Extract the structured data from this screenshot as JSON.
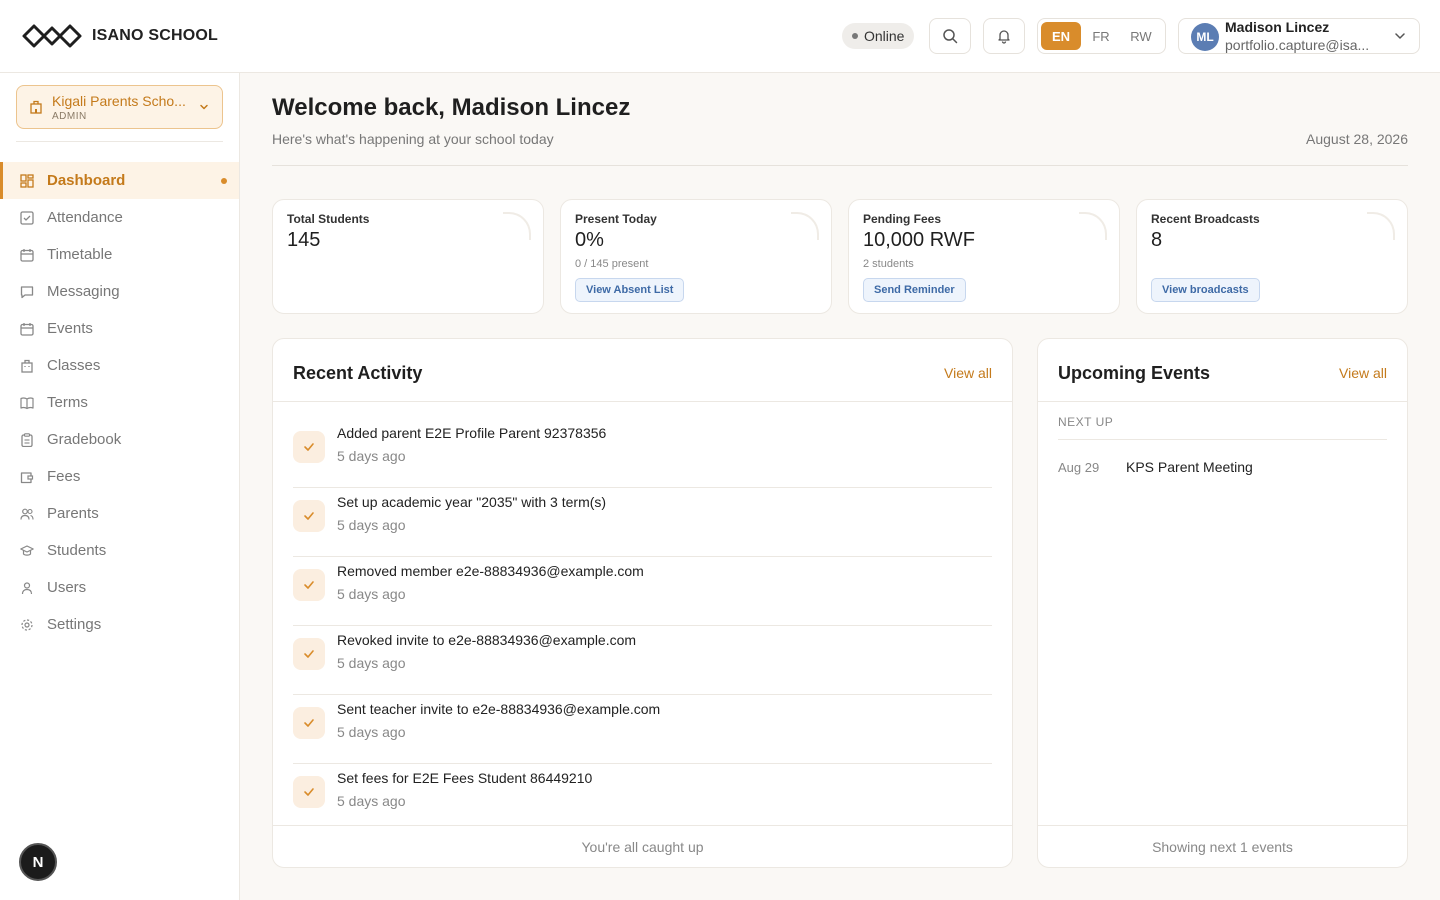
{
  "app": {
    "brand": "ISANO SCHOOL",
    "status": "Online",
    "languages": [
      "EN",
      "FR",
      "RW"
    ],
    "active_language": "EN"
  },
  "user": {
    "initials": "ML",
    "name": "Madison Lincez",
    "email": "portfolio.capture@isa..."
  },
  "school": {
    "name": "Kigali Parents Scho...",
    "role": "ADMIN"
  },
  "sidebar": {
    "items": [
      {
        "label": "Dashboard",
        "icon": "dashboard-icon",
        "active": true
      },
      {
        "label": "Attendance",
        "icon": "check-square-icon"
      },
      {
        "label": "Timetable",
        "icon": "calendar-icon"
      },
      {
        "label": "Messaging",
        "icon": "message-icon"
      },
      {
        "label": "Events",
        "icon": "calendar-icon"
      },
      {
        "label": "Classes",
        "icon": "building-icon"
      },
      {
        "label": "Terms",
        "icon": "book-icon"
      },
      {
        "label": "Gradebook",
        "icon": "clipboard-icon"
      },
      {
        "label": "Fees",
        "icon": "wallet-icon"
      },
      {
        "label": "Parents",
        "icon": "users-icon"
      },
      {
        "label": "Students",
        "icon": "graduation-cap-icon"
      },
      {
        "label": "Users",
        "icon": "user-icon"
      },
      {
        "label": "Settings",
        "icon": "gear-icon"
      }
    ],
    "badge": "N"
  },
  "main": {
    "welcome": "Welcome back, Madison Lincez",
    "subtitle": "Here's what's happening at your school today",
    "date": "August 28, 2026"
  },
  "stats": [
    {
      "label": "Total Students",
      "value": "145",
      "note": "",
      "button": ""
    },
    {
      "label": "Present Today",
      "value": "0%",
      "note": "0 / 145 present",
      "button": "View Absent List"
    },
    {
      "label": "Pending Fees",
      "value": "10,000 RWF",
      "note": "2 students",
      "button": "Send Reminder"
    },
    {
      "label": "Recent Broadcasts",
      "value": "8",
      "note": "",
      "button": "View broadcasts"
    }
  ],
  "activity": {
    "title": "Recent Activity",
    "view_all": "View all",
    "items": [
      {
        "text": "Added parent E2E Profile Parent 92378356",
        "when": "5 days ago"
      },
      {
        "text": "Set up academic year \"2035\" with 3 term(s)",
        "when": "5 days ago"
      },
      {
        "text": "Removed member e2e-88834936@example.com",
        "when": "5 days ago"
      },
      {
        "text": "Revoked invite to e2e-88834936@example.com",
        "when": "5 days ago"
      },
      {
        "text": "Sent teacher invite to e2e-88834936@example.com",
        "when": "5 days ago"
      },
      {
        "text": "Set fees for E2E Fees Student 86449210",
        "when": "5 days ago"
      }
    ],
    "footer": "You're all caught up"
  },
  "events": {
    "title": "Upcoming Events",
    "view_all": "View all",
    "section": "NEXT UP",
    "items": [
      {
        "date": "Aug 29",
        "title": "KPS Parent Meeting"
      }
    ],
    "footer": "Showing next 1 events"
  },
  "colors": {
    "accent": "#d98c2b",
    "accent_text": "#c47a1b",
    "accent_bg": "#fdf3e6",
    "link_blue": "#3e6aa6"
  }
}
